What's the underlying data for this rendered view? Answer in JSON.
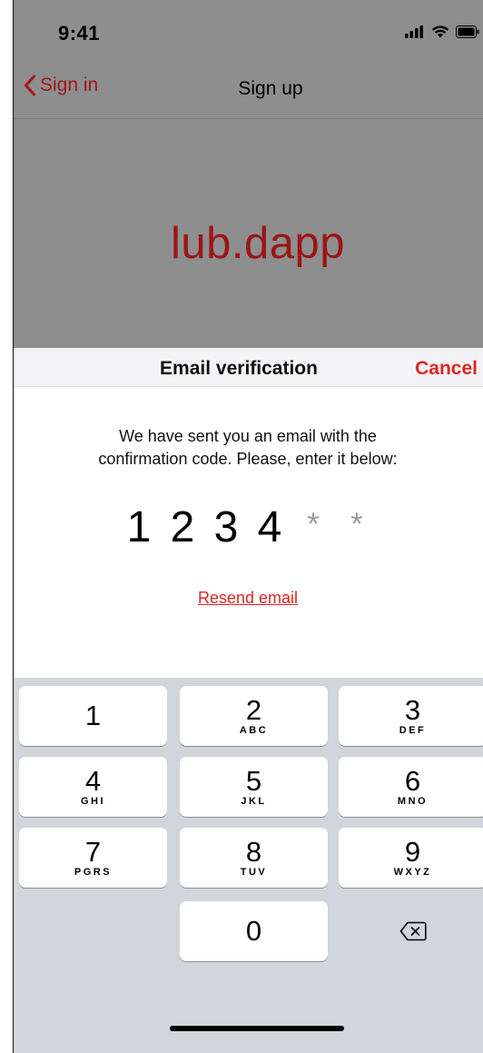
{
  "status": {
    "time": "9:41"
  },
  "nav": {
    "back_label": "Sign in",
    "title": "Sign up"
  },
  "brand": {
    "logo_text": "lub.dapp"
  },
  "sheet": {
    "title": "Email verification",
    "cancel_label": "Cancel",
    "message_line1": "We have sent you an email with the",
    "message_line2": "confirmation code. Please, enter it below:",
    "code_digits": [
      "1",
      "2",
      "3",
      "4"
    ],
    "code_masks": [
      "*",
      "*"
    ],
    "resend_label": "Resend email"
  },
  "keypad": {
    "keys": [
      {
        "num": "1",
        "letters": ""
      },
      {
        "num": "2",
        "letters": "ABC"
      },
      {
        "num": "3",
        "letters": "DEF"
      },
      {
        "num": "4",
        "letters": "GHI"
      },
      {
        "num": "5",
        "letters": "JKL"
      },
      {
        "num": "6",
        "letters": "MNO"
      },
      {
        "num": "7",
        "letters": "PGRS"
      },
      {
        "num": "8",
        "letters": "TUV"
      },
      {
        "num": "9",
        "letters": "WXYZ"
      },
      {
        "num": "0",
        "letters": ""
      }
    ],
    "delete_icon": "delete-icon"
  },
  "colors": {
    "accent": "#e02424",
    "brand": "#9c1515",
    "dim_overlay": "#8e8e8e",
    "keypad_bg": "#d2d5db"
  }
}
